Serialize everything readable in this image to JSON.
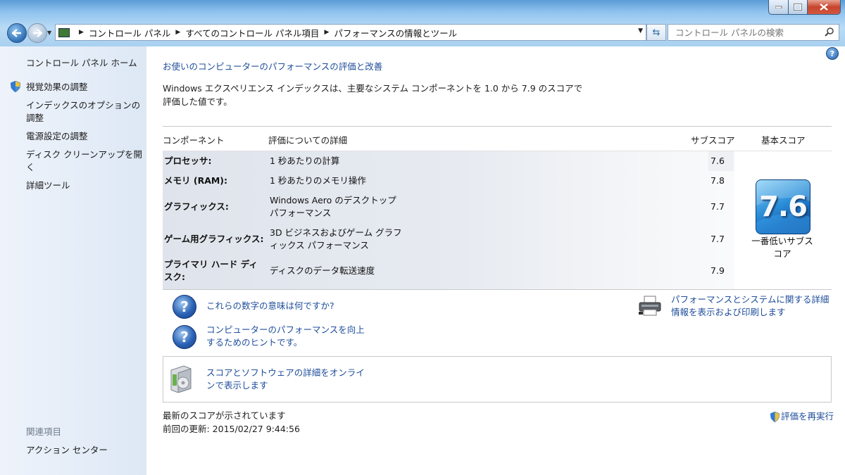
{
  "window": {
    "address_crumbs": [
      "コントロール パネル",
      "すべてのコントロール パネル項目",
      "パフォーマンスの情報とツール"
    ],
    "search_placeholder": "コントロール パネルの検索"
  },
  "sidebar": {
    "home": "コントロール パネル ホーム",
    "items": [
      "視覚効果の調整",
      "インデックスのオプションの調整",
      "電源設定の調整",
      "ディスク クリーンアップを開く",
      "詳細ツール"
    ],
    "related_title": "関連項目",
    "related_items": [
      "アクション センター"
    ]
  },
  "main": {
    "heading": "お使いのコンピューターのパフォーマンスの評価と改善",
    "description": "Windows エクスペリエンス インデックスは、主要なシステム コンポーネントを 1.0 から 7.9 のスコアで評価した値です。",
    "table": {
      "headers": {
        "component": "コンポーネント",
        "details": "評価についての詳細",
        "subscore": "サブスコア",
        "base": "基本スコア"
      },
      "rows": [
        {
          "component": "プロセッサ:",
          "details": "1 秒あたりの計算",
          "subscore": "7.6"
        },
        {
          "component": "メモリ (RAM):",
          "details": "1 秒あたりのメモリ操作",
          "subscore": "7.8"
        },
        {
          "component": "グラフィックス:",
          "details": "Windows Aero のデスクトップ パフォーマンス",
          "subscore": "7.7"
        },
        {
          "component": "ゲーム用グラフィックス:",
          "details": "3D ビジネスおよびゲーム グラフィックス パフォーマンス",
          "subscore": "7.7"
        },
        {
          "component": "プライマリ ハード ディスク:",
          "details": "ディスクのデータ転送速度",
          "subscore": "7.9"
        }
      ],
      "base_score": "7.6",
      "base_caption": "一番低いサブスコア"
    },
    "links": {
      "what_mean": "これらの数字の意味は何ですか?",
      "tips": "コンピューターのパフォーマンスを向上するためのヒントです。",
      "print_details": "パフォーマンスとシステムに関する詳細情報を表示および印刷します",
      "online": "スコアとソフトウェアの詳細をオンラインで表示します"
    },
    "status": {
      "current": "最新のスコアが示されています",
      "last_update": "前回の更新: 2015/02/27 9:44:56"
    },
    "rerun": "評価を再実行"
  },
  "colors": {
    "link": "#1e4d9b",
    "badge": "#2c8fd9"
  }
}
